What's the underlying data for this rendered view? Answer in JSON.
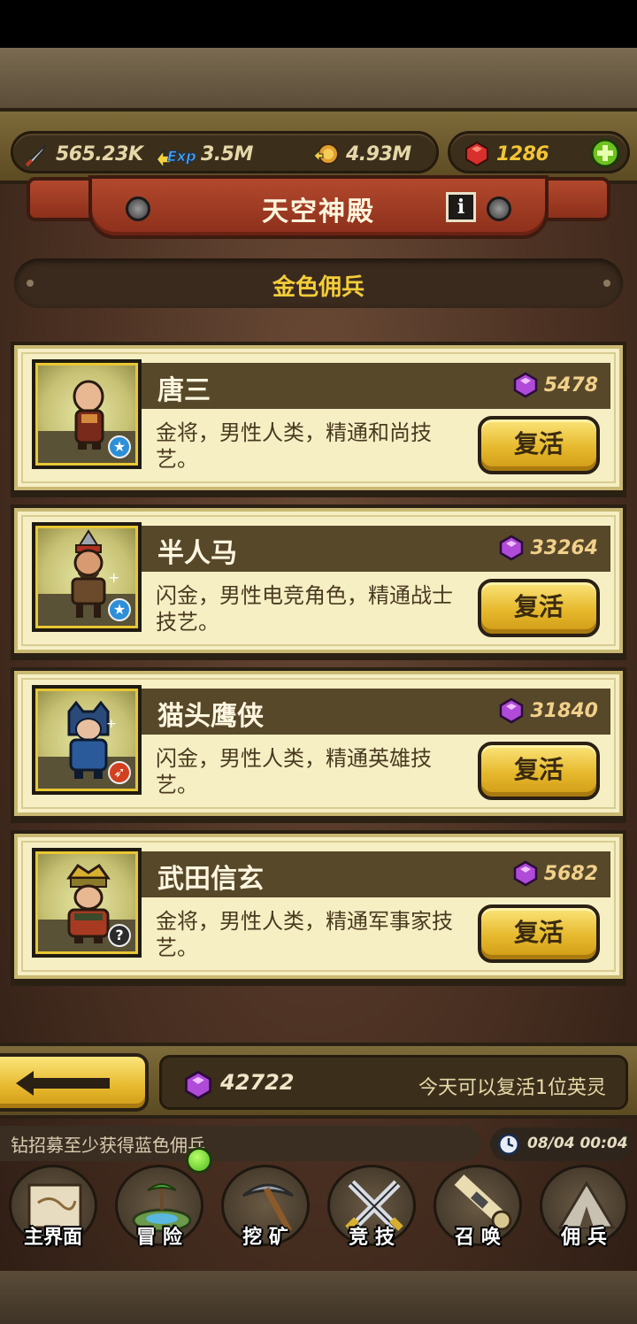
{
  "resources": {
    "attack": "565.23K",
    "exp": "3.5M",
    "gold": "4.93M",
    "ruby": "1286"
  },
  "header": {
    "title": "天空神殿",
    "info_label": "i"
  },
  "section_title": "金色佣兵",
  "heroes": [
    {
      "name": "唐三",
      "cost": "5478",
      "desc": "金将，男性人类，精通和尚技艺。",
      "action": "复活",
      "badge": "★"
    },
    {
      "name": "半人马",
      "cost": "33264",
      "desc": "闪金，男性电竞角色，精通战士技艺。",
      "action": "复活",
      "badge": "★"
    },
    {
      "name": "猫头鹰侠",
      "cost": "31840",
      "desc": "闪金，男性人类，精通英雄技艺。",
      "action": "复活",
      "badge": "➶"
    },
    {
      "name": "武田信玄",
      "cost": "5682",
      "desc": "金将，男性人类，精通军事家技艺。",
      "action": "复活",
      "badge": "?"
    }
  ],
  "footer": {
    "gem_total": "42722",
    "revive_note": "今天可以复活1位英灵"
  },
  "ticker": {
    "text": "钻招募至少获得蓝色佣兵",
    "time": "08/04 00:04"
  },
  "nav": [
    {
      "label": "主界面"
    },
    {
      "label": "冒 险"
    },
    {
      "label": "挖 矿"
    },
    {
      "label": "竞 技"
    },
    {
      "label": "召 唤"
    },
    {
      "label": "佣 兵"
    }
  ],
  "colors": {
    "accent_gold": "#f4cd3a",
    "card_bg": "#f6efc4",
    "banner_red": "#b2492d",
    "ruby": "#d8302c",
    "gem": "#b04ad8"
  }
}
